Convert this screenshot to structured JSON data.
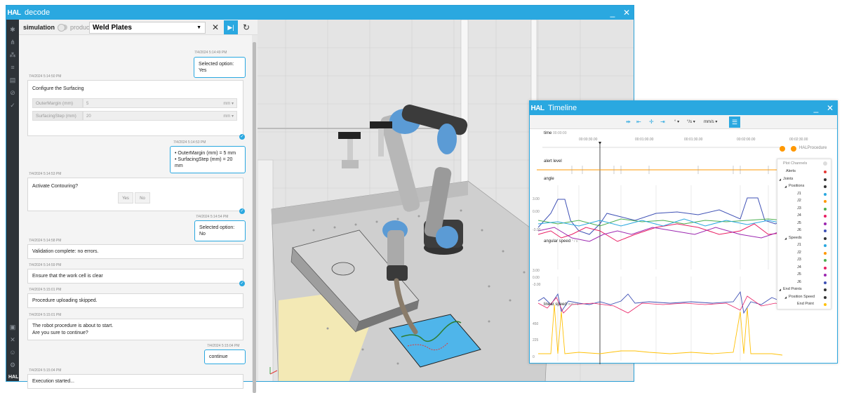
{
  "main_window": {
    "logo": "HAL",
    "title": "decode",
    "minimize": "_",
    "close": "✕"
  },
  "toolbar": {
    "simulation_label": "simulation",
    "production_label": "production",
    "procedure": "Weld Plates"
  },
  "chat": [
    {
      "id": "m1",
      "type": "reply",
      "timestamp": "7/4/2024 5:14:49 PM",
      "text": "Selected option: Yes"
    },
    {
      "id": "m2",
      "type": "form",
      "timestamp": "7/4/2024 5:14:50 PM",
      "title": "Configure the Surfacing",
      "fields": [
        {
          "label": "OuterMargin (mm)",
          "value": "5",
          "unit": "mm"
        },
        {
          "label": "SurfacingStep (mm)",
          "value": "20",
          "unit": "mm"
        }
      ]
    },
    {
      "id": "m3",
      "type": "reply",
      "timestamp": "7/4/2024 5:14:53 PM",
      "lines": [
        "• OuterMargin (mm) = 5 mm",
        "• SurfacingStep (mm) = 20 mm"
      ]
    },
    {
      "id": "m4",
      "type": "question",
      "timestamp": "7/4/2024 5:14:53 PM",
      "text": "Activate Contouring?",
      "yes": "Yes",
      "no": "No"
    },
    {
      "id": "m5",
      "type": "reply",
      "timestamp": "7/4/2024 5:14:54 PM",
      "text": "Selected option: No"
    },
    {
      "id": "m6",
      "type": "message",
      "timestamp": "7/4/2024 5:14:58 PM",
      "text": "Validation complete: no errors."
    },
    {
      "id": "m7",
      "type": "message",
      "timestamp": "7/4/2024 5:14:59 PM",
      "text": "Ensure that the work cell is clear"
    },
    {
      "id": "m8",
      "type": "message",
      "timestamp": "7/4/2024 5:15:01 PM",
      "text": "Procedure uploading skipped."
    },
    {
      "id": "m9",
      "type": "message",
      "timestamp": "7/4/2024 5:15:01 PM",
      "lines": [
        "The robot procedure is about to start.",
        "Are you sure to continue?"
      ]
    },
    {
      "id": "m10",
      "type": "reply",
      "timestamp": "7/4/2024 5:15:04 PM",
      "text": "continue"
    },
    {
      "id": "m11",
      "type": "message",
      "timestamp": "7/4/2024 5:15:04 PM",
      "text": "Execution started..."
    }
  ],
  "timeline": {
    "logo": "HAL",
    "title": "Timeline",
    "minimize": "_",
    "close": "✕",
    "units": {
      "angular": "°/s",
      "linear": "mm/s"
    },
    "time_label": "time",
    "time_value": "00:00:00",
    "ticks": [
      "00:00:30.00",
      "00:01:00.00",
      "00:01:30.00",
      "00:02:00.00",
      "00:02:30.00",
      "00:03:00.00"
    ],
    "procedure_label": "HALProcedure",
    "channels": [
      {
        "label": "alert level",
        "unit": ""
      },
      {
        "label": "angle",
        "unit": ""
      },
      {
        "label": "angular speed",
        "unit": "° / s"
      },
      {
        "label": "linear speed",
        "unit": "mm / s"
      }
    ],
    "angle_ticks": [
      "3.00",
      "0.00",
      "-3.00"
    ],
    "speed_ticks": [
      "3.00",
      "0.00",
      "-3.00"
    ],
    "linear_ticks": [
      "450",
      "225",
      "0"
    ],
    "plot_channels": {
      "title": "Plot Channels",
      "items": [
        {
          "label": "Alerts",
          "indent": 0,
          "color": "#e53935"
        },
        {
          "label": "Joints",
          "indent": 0,
          "color": "#333333",
          "tree": true
        },
        {
          "label": "Positions",
          "indent": 1,
          "color": "#333333",
          "tree": true
        },
        {
          "label": "J1",
          "indent": 2,
          "color": "#2aa8e0"
        },
        {
          "label": "J2",
          "indent": 2,
          "color": "#ff9800"
        },
        {
          "label": "J3",
          "indent": 2,
          "color": "#4caf50"
        },
        {
          "label": "J4",
          "indent": 2,
          "color": "#e91e63"
        },
        {
          "label": "J5",
          "indent": 2,
          "color": "#9c27b0"
        },
        {
          "label": "J6",
          "indent": 2,
          "color": "#3f51b5"
        },
        {
          "label": "Speeds",
          "indent": 1,
          "color": "#333333",
          "tree": true
        },
        {
          "label": "J1",
          "indent": 2,
          "color": "#2aa8e0"
        },
        {
          "label": "J2",
          "indent": 2,
          "color": "#ff9800"
        },
        {
          "label": "J3",
          "indent": 2,
          "color": "#4caf50"
        },
        {
          "label": "J4",
          "indent": 2,
          "color": "#e91e63"
        },
        {
          "label": "J5",
          "indent": 2,
          "color": "#9c27b0"
        },
        {
          "label": "J6",
          "indent": 2,
          "color": "#3f51b5"
        },
        {
          "label": "End Points",
          "indent": 0,
          "color": "#333333",
          "tree": true
        },
        {
          "label": "Position Speed",
          "indent": 1,
          "color": "#333333",
          "tree": true
        },
        {
          "label": "End Point",
          "indent": 2,
          "color": "#ffc107"
        }
      ]
    }
  },
  "colors": {
    "accent": "#2aa8e0",
    "sidebar": "#2e3338"
  }
}
